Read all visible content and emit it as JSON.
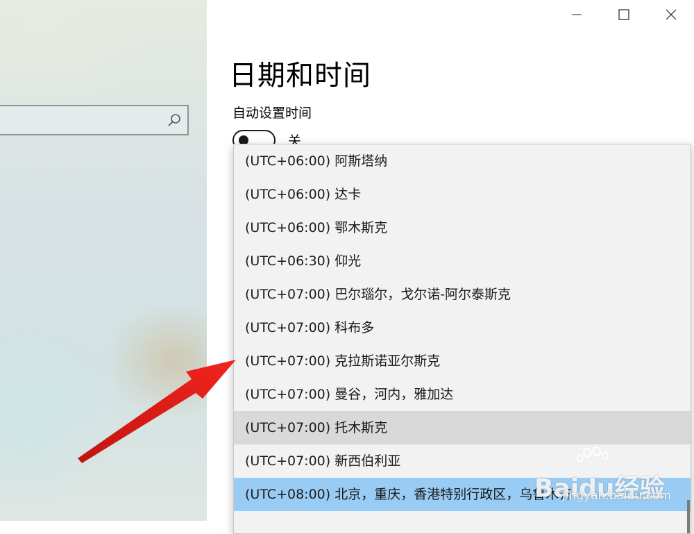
{
  "window": {
    "controls": {
      "minimize": "minimize-icon",
      "maximize": "maximize-icon",
      "close": "close-icon"
    }
  },
  "sidebar": {
    "search": {
      "placeholder": "",
      "icon": "search-icon"
    }
  },
  "main": {
    "title": "日期和时间",
    "auto_time": {
      "label": "自动设置时间",
      "state": "关",
      "on": false
    }
  },
  "timezone_dropdown": {
    "options": [
      "(UTC+06:00) 阿斯塔纳",
      "(UTC+06:00) 达卡",
      "(UTC+06:00) 鄂木斯克",
      "(UTC+06:30) 仰光",
      "(UTC+07:00) 巴尔瑙尔，戈尔诺-阿尔泰斯克",
      "(UTC+07:00) 科布多",
      "(UTC+07:00) 克拉斯诺亚尔斯克",
      "(UTC+07:00) 曼谷，河内，雅加达",
      "(UTC+07:00) 托木斯克",
      "(UTC+07:00) 新西伯利亚",
      "(UTC+08:00) 北京，重庆，香港特别行政区，乌鲁木齐"
    ],
    "hover_index": 8,
    "selected_index": 10
  },
  "watermark": {
    "brand": "Baidu经验",
    "url": "jingyan.baidu.com"
  },
  "colors": {
    "selected": "#99ccf4",
    "hover": "#d9d9d9",
    "annotation_arrow": "#e8201c"
  }
}
